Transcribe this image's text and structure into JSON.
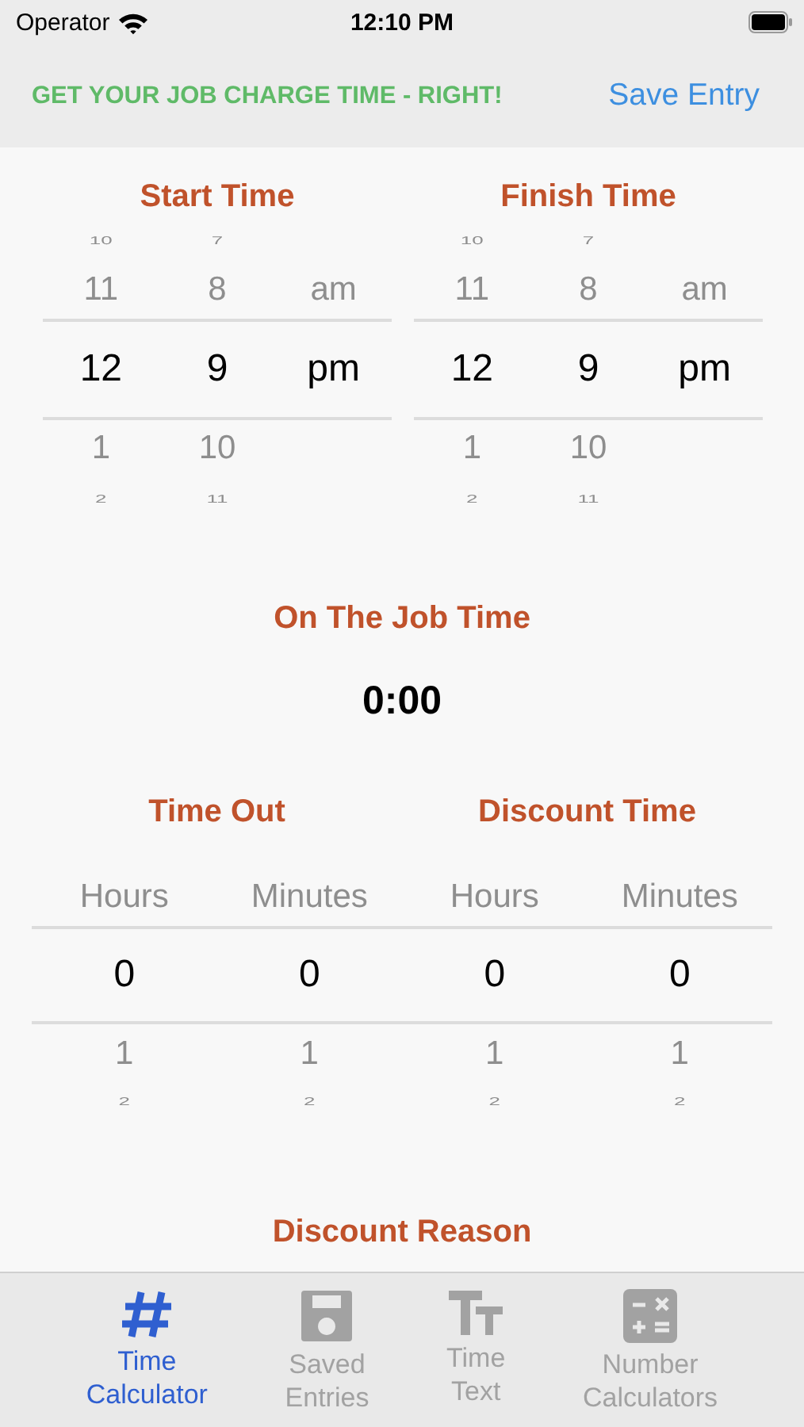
{
  "status_bar": {
    "carrier": "Operator",
    "time": "12:10 PM"
  },
  "nav_bar": {
    "tagline": "GET YOUR JOB CHARGE TIME - RIGHT!",
    "action": "Save Entry"
  },
  "time_pickers": [
    {
      "title": "Start Time",
      "columns": [
        {
          "items": [
            {
              "text": "10",
              "selected": false
            },
            {
              "text": "11",
              "selected": false
            },
            {
              "text": "12",
              "selected": true
            },
            {
              "text": "1",
              "selected": false
            },
            {
              "text": "2",
              "selected": false
            }
          ]
        },
        {
          "items": [
            {
              "text": "7",
              "selected": false
            },
            {
              "text": "8",
              "selected": false
            },
            {
              "text": "9",
              "selected": true
            },
            {
              "text": "10",
              "selected": false
            },
            {
              "text": "11",
              "selected": false
            }
          ]
        },
        {
          "items": [
            {
              "text": "am",
              "selected": false
            },
            {
              "text": "pm",
              "selected": true
            }
          ]
        }
      ]
    },
    {
      "title": "Finish Time",
      "columns": [
        {
          "items": [
            {
              "text": "10",
              "selected": false
            },
            {
              "text": "11",
              "selected": false
            },
            {
              "text": "12",
              "selected": true
            },
            {
              "text": "1",
              "selected": false
            },
            {
              "text": "2",
              "selected": false
            }
          ]
        },
        {
          "items": [
            {
              "text": "7",
              "selected": false
            },
            {
              "text": "8",
              "selected": false
            },
            {
              "text": "9",
              "selected": true
            },
            {
              "text": "10",
              "selected": false
            },
            {
              "text": "11",
              "selected": false
            }
          ]
        },
        {
          "items": [
            {
              "text": "am",
              "selected": false
            },
            {
              "text": "pm",
              "selected": true
            }
          ]
        }
      ]
    }
  ],
  "job_time": {
    "label": "On The Job Time",
    "value": "0:00"
  },
  "duration_pickers": [
    {
      "title": "Time Out",
      "columns": [
        {
          "header": "Hours",
          "items": [
            {
              "text": "0",
              "selected": true
            },
            {
              "text": "1",
              "selected": false
            },
            {
              "text": "2",
              "selected": false
            }
          ]
        },
        {
          "header": "Minutes",
          "items": [
            {
              "text": "0",
              "selected": true
            },
            {
              "text": "1",
              "selected": false
            },
            {
              "text": "2",
              "selected": false
            }
          ]
        }
      ]
    },
    {
      "title": "Discount Time",
      "columns": [
        {
          "header": "Hours",
          "items": [
            {
              "text": "0",
              "selected": true
            },
            {
              "text": "1",
              "selected": false
            },
            {
              "text": "2",
              "selected": false
            }
          ]
        },
        {
          "header": "Minutes",
          "items": [
            {
              "text": "0",
              "selected": true
            },
            {
              "text": "1",
              "selected": false
            },
            {
              "text": "2",
              "selected": false
            }
          ]
        }
      ]
    }
  ],
  "next_section": {
    "title": "Discount Reason"
  },
  "tab_bar": [
    {
      "label": "Time\nCalculator",
      "selected": true
    },
    {
      "label": "Saved\nEntries",
      "selected": false
    },
    {
      "label": "Time\nText",
      "selected": false
    },
    {
      "label": "Number\nCalculators",
      "selected": false
    }
  ]
}
